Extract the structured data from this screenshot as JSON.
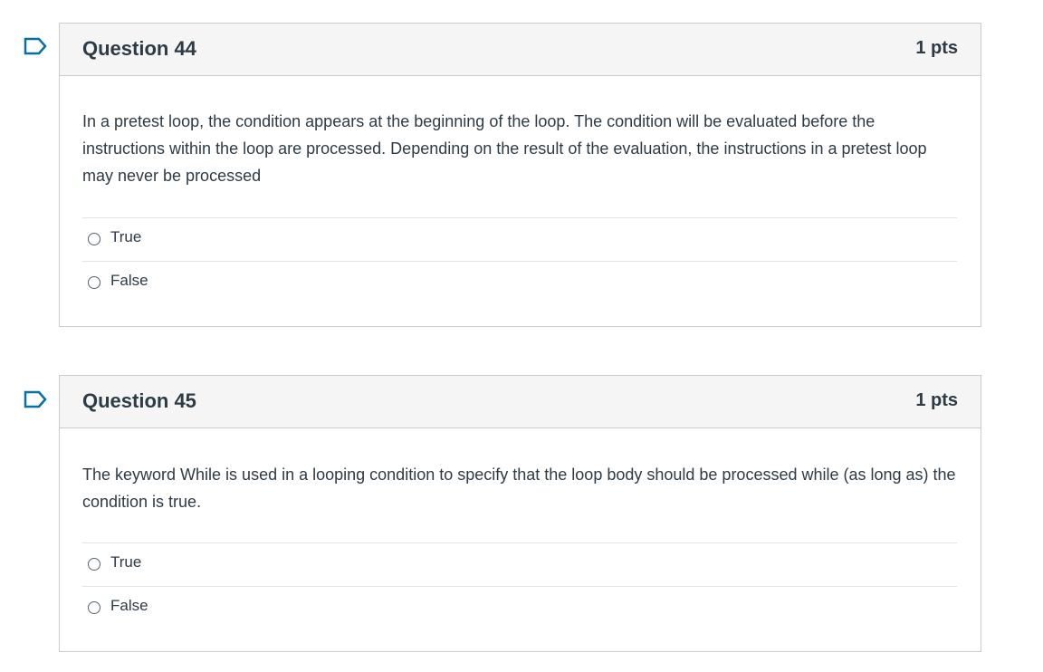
{
  "questions": [
    {
      "title": "Question 44",
      "points": "1 pts",
      "text": "In a pretest loop, the condition appears at the beginning of the loop. The condition will be evaluated before the instructions within the loop are processed. Depending on the result of the evaluation, the instructions in a pretest loop may never be processed",
      "answers": [
        "True",
        "False"
      ]
    },
    {
      "title": "Question 45",
      "points": "1 pts",
      "text": "The keyword While is used in a looping condition to specify that the loop body should be processed while (as long as) the condition is true.",
      "answers": [
        "True",
        "False"
      ]
    }
  ],
  "icons": {
    "flag": "bookmark-flag-icon",
    "radio": "radio-unselected"
  },
  "colors": {
    "flag": "#0770a3",
    "border": "#c7cdd1",
    "header_bg": "#f5f5f5",
    "text": "#2d3b45"
  }
}
